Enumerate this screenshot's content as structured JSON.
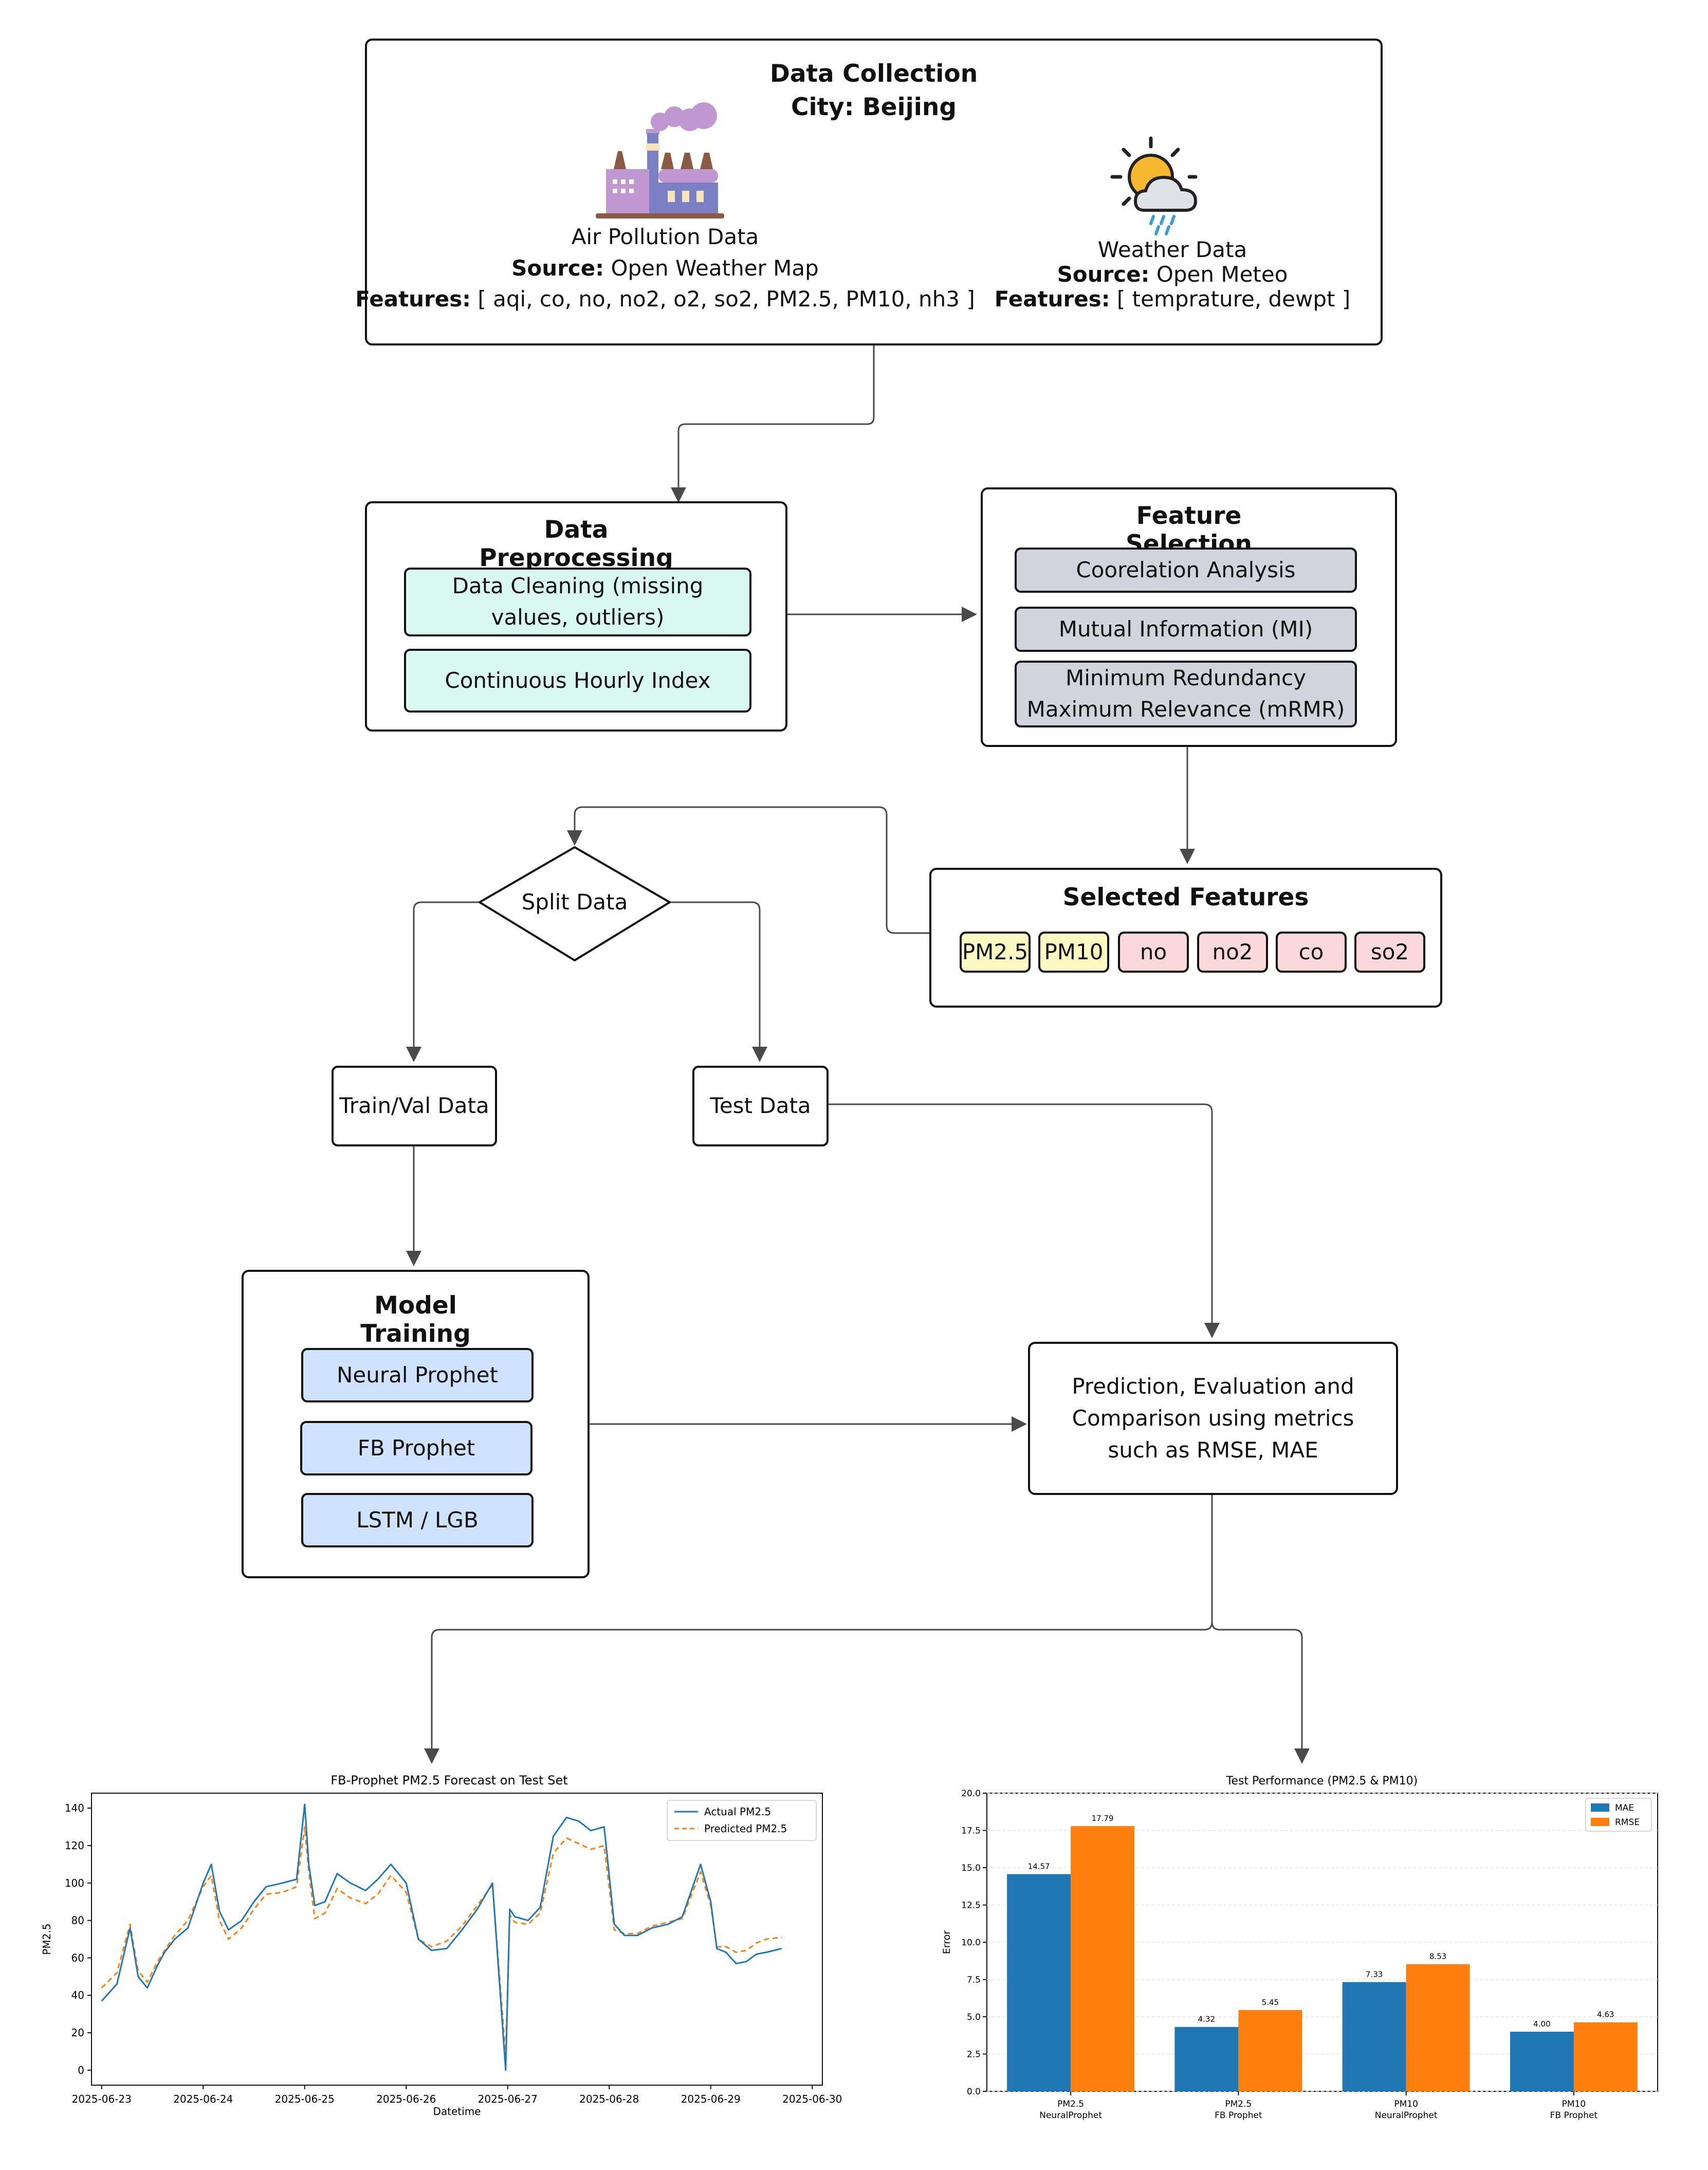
{
  "data_collection": {
    "title": "Data Collection",
    "city": "City: Beijing",
    "air": {
      "name": "Air Pollution Data",
      "source_label": "Source:",
      "source": "Open Weather Map",
      "features_label": "Features:",
      "features": "[ aqi, co, no, no2, o2, so2, PM2.5, PM10, nh3 ]"
    },
    "weather": {
      "name": "Weather Data",
      "source_label": "Source:",
      "source": "Open Meteo",
      "features_label": "Features:",
      "features": "[ temprature, dewpt ]"
    }
  },
  "preprocessing": {
    "title": "Data Preprocessing",
    "items": [
      "Data Cleaning (missing values, outliers)",
      "Continuous Hourly Index"
    ]
  },
  "feature_selection": {
    "title": "Feature Selection",
    "items": [
      "Coorelation Analysis",
      "Mutual Information (MI)",
      "Minimum Redundancy Maximum Relevance (mRMR)"
    ]
  },
  "selected_features": {
    "title": "Selected Features",
    "items": [
      "PM2.5",
      "PM10",
      "no",
      "no2",
      "co",
      "so2"
    ]
  },
  "split": {
    "label": "Split Data"
  },
  "train_val": {
    "label": "Train/Val Data"
  },
  "test": {
    "label": "Test Data"
  },
  "model_training": {
    "title": "Model Training",
    "items": [
      "Neural Prophet",
      "FB Prophet",
      "LSTM / LGB"
    ]
  },
  "prediction": {
    "label": "Prediction, Evaluation and Comparison using metrics such as RMSE, MAE"
  },
  "colors": {
    "line": "#4a4a4a",
    "actual": "#1f77b4",
    "predicted": "#ff7f0e",
    "mae": "#1f77b4",
    "rmse": "#ff7f0e"
  },
  "chart_data": [
    {
      "type": "line",
      "title": "FB-Prophet PM2.5 Forecast on Test Set",
      "xlabel": "Datetime",
      "ylabel": "PM2.5",
      "xlim": [
        -0.1,
        7.1
      ],
      "ylim": [
        -8,
        148
      ],
      "x_ticks": [
        0,
        1,
        2,
        3,
        4,
        5,
        6,
        7
      ],
      "x_tick_labels": [
        "2025-06-23",
        "2025-06-24",
        "2025-06-25",
        "2025-06-26",
        "2025-06-27",
        "2025-06-28",
        "2025-06-29",
        "2025-06-30"
      ],
      "y_ticks": [
        0,
        20,
        40,
        60,
        80,
        100,
        120,
        140
      ],
      "legend": "top-right",
      "x": [
        0.0,
        0.15,
        0.28,
        0.36,
        0.45,
        0.55,
        0.62,
        0.72,
        0.85,
        1.0,
        1.08,
        1.16,
        1.25,
        1.38,
        1.5,
        1.62,
        1.78,
        1.92,
        2.0,
        2.04,
        2.1,
        2.2,
        2.32,
        2.45,
        2.6,
        2.72,
        2.85,
        3.0,
        3.12,
        3.25,
        3.4,
        3.55,
        3.7,
        3.85,
        3.98,
        4.02,
        4.07,
        4.2,
        4.32,
        4.45,
        4.58,
        4.7,
        4.82,
        4.95,
        5.05,
        5.15,
        5.28,
        5.42,
        5.58,
        5.72,
        5.9,
        6.0,
        6.06,
        6.15,
        6.25,
        6.35,
        6.45,
        6.55,
        6.7
      ],
      "series": [
        {
          "name": "Actual PM2.5",
          "style": "solid",
          "values": [
            37,
            46,
            76,
            50,
            44,
            56,
            63,
            70,
            76,
            100,
            110,
            85,
            75,
            80,
            90,
            98,
            100,
            102,
            142,
            110,
            88,
            90,
            105,
            100,
            96,
            102,
            110,
            100,
            70,
            64,
            65,
            75,
            86,
            100,
            0,
            86,
            82,
            80,
            87,
            125,
            135,
            133,
            128,
            130,
            78,
            72,
            72,
            76,
            78,
            82,
            110,
            90,
            65,
            63,
            57,
            58,
            62,
            63,
            65
          ]
        },
        {
          "name": "Predicted PM2.5",
          "style": "dashed",
          "values": [
            44,
            52,
            78,
            53,
            47,
            58,
            64,
            72,
            80,
            98,
            104,
            80,
            70,
            76,
            86,
            94,
            95,
            98,
            130,
            106,
            81,
            84,
            97,
            92,
            89,
            94,
            104,
            95,
            70,
            66,
            69,
            77,
            88,
            99,
            8,
            83,
            79,
            78,
            84,
            116,
            124,
            121,
            118,
            120,
            75,
            73,
            73,
            77,
            79,
            81,
            106,
            88,
            66,
            66,
            63,
            64,
            68,
            70,
            71
          ]
        }
      ]
    },
    {
      "type": "bar",
      "title": "Test Performance (PM2.5 & PM10)",
      "ylabel": "Error",
      "ylim": [
        0,
        20.0
      ],
      "y_ticks": [
        0.0,
        2.5,
        5.0,
        7.5,
        10.0,
        12.5,
        15.0,
        17.5,
        20.0
      ],
      "y_tick_labels": [
        "0.0",
        "2.5",
        "5.0",
        "7.5",
        "10.0",
        "12.5",
        "15.0",
        "17.5",
        "20.0"
      ],
      "grid": true,
      "legend": "top-right",
      "categories": [
        "PM2.5\nNeuralProphet",
        "PM2.5\nFB Prophet",
        "PM10\nNeuralProphet",
        "PM10\nFB Prophet"
      ],
      "series": [
        {
          "name": "MAE",
          "values": [
            14.57,
            4.32,
            7.33,
            4.0
          ],
          "labels": [
            "14.57",
            "4.32",
            "7.33",
            "4.00"
          ]
        },
        {
          "name": "RMSE",
          "values": [
            17.79,
            5.45,
            8.53,
            4.63
          ],
          "labels": [
            "17.79",
            "5.45",
            "8.53",
            "4.63"
          ]
        }
      ]
    }
  ]
}
